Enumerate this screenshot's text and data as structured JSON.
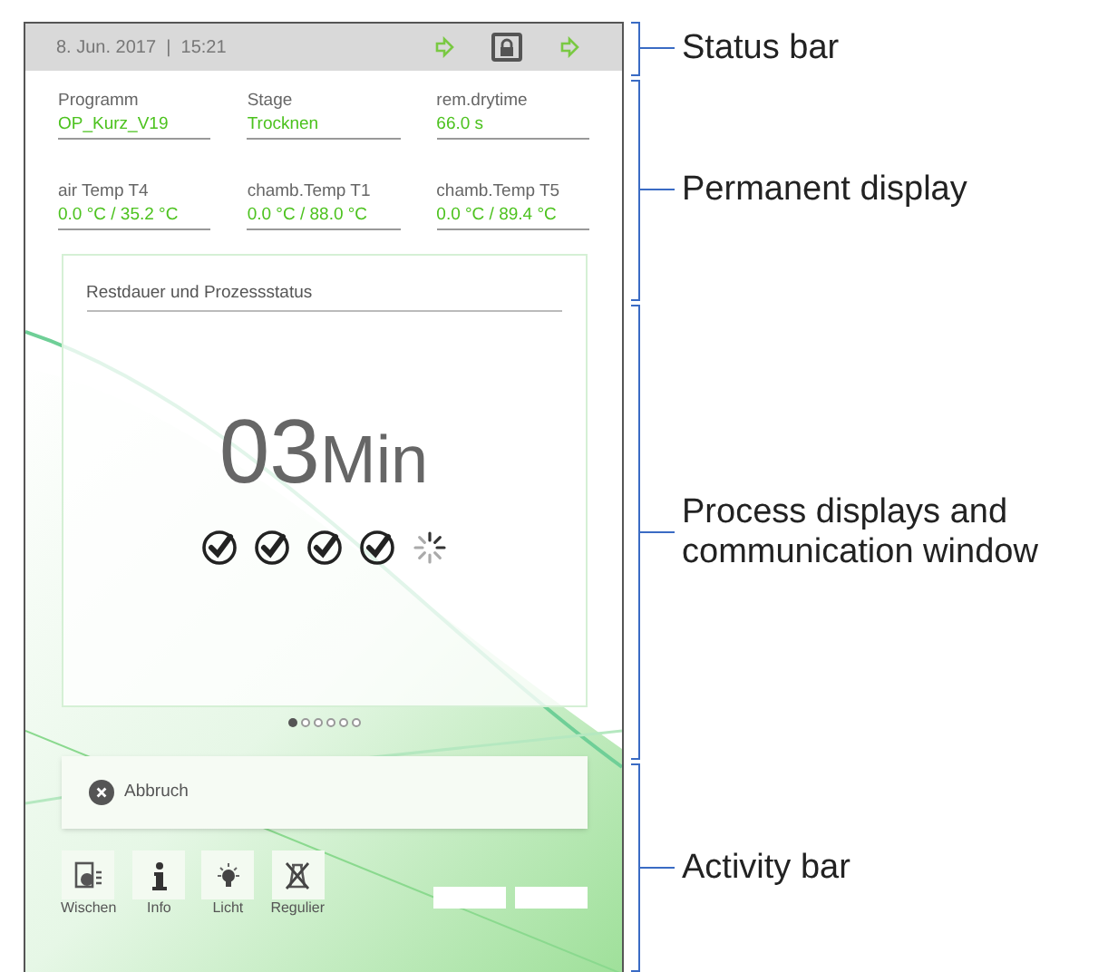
{
  "status_bar": {
    "datetime": "8. Jun. 2017  |  15:21"
  },
  "permanent_display": [
    {
      "label": "Programm",
      "value": "OP_Kurz_V19"
    },
    {
      "label": "Stage",
      "value": "Trocknen"
    },
    {
      "label": "rem.drytime",
      "value": "66.0 s"
    },
    {
      "label": "air Temp T4",
      "value": "0.0 °C / 35.2 °C"
    },
    {
      "label": "chamb.Temp T1",
      "value": "0.0 °C / 88.0 °C"
    },
    {
      "label": "chamb.Temp T5",
      "value": "0.0 °C / 89.4 °C"
    }
  ],
  "process_card": {
    "title": "Restdauer und Prozessstatus",
    "time_value": "03",
    "time_unit": "Min",
    "steps": [
      {
        "done": true
      },
      {
        "done": true
      },
      {
        "done": true
      },
      {
        "done": true
      },
      {
        "done": false
      }
    ]
  },
  "pager": [
    {
      "selected": true
    },
    {
      "selected": false
    },
    {
      "selected": false
    },
    {
      "selected": false
    },
    {
      "selected": false
    },
    {
      "selected": false
    }
  ],
  "cancel_button": {
    "label": "Abbruch"
  },
  "activity_buttons": [
    {
      "kind": "wipe",
      "label": "Wischen"
    },
    {
      "kind": "info",
      "label": "Info"
    },
    {
      "kind": "light",
      "label": "Licht"
    },
    {
      "kind": "regulate",
      "label": "Regulier"
    }
  ],
  "annotations": [
    {
      "label": "Status bar"
    },
    {
      "label": "Permanent display"
    },
    {
      "label": "Process displays and communication window"
    },
    {
      "label": "Activity bar"
    }
  ]
}
